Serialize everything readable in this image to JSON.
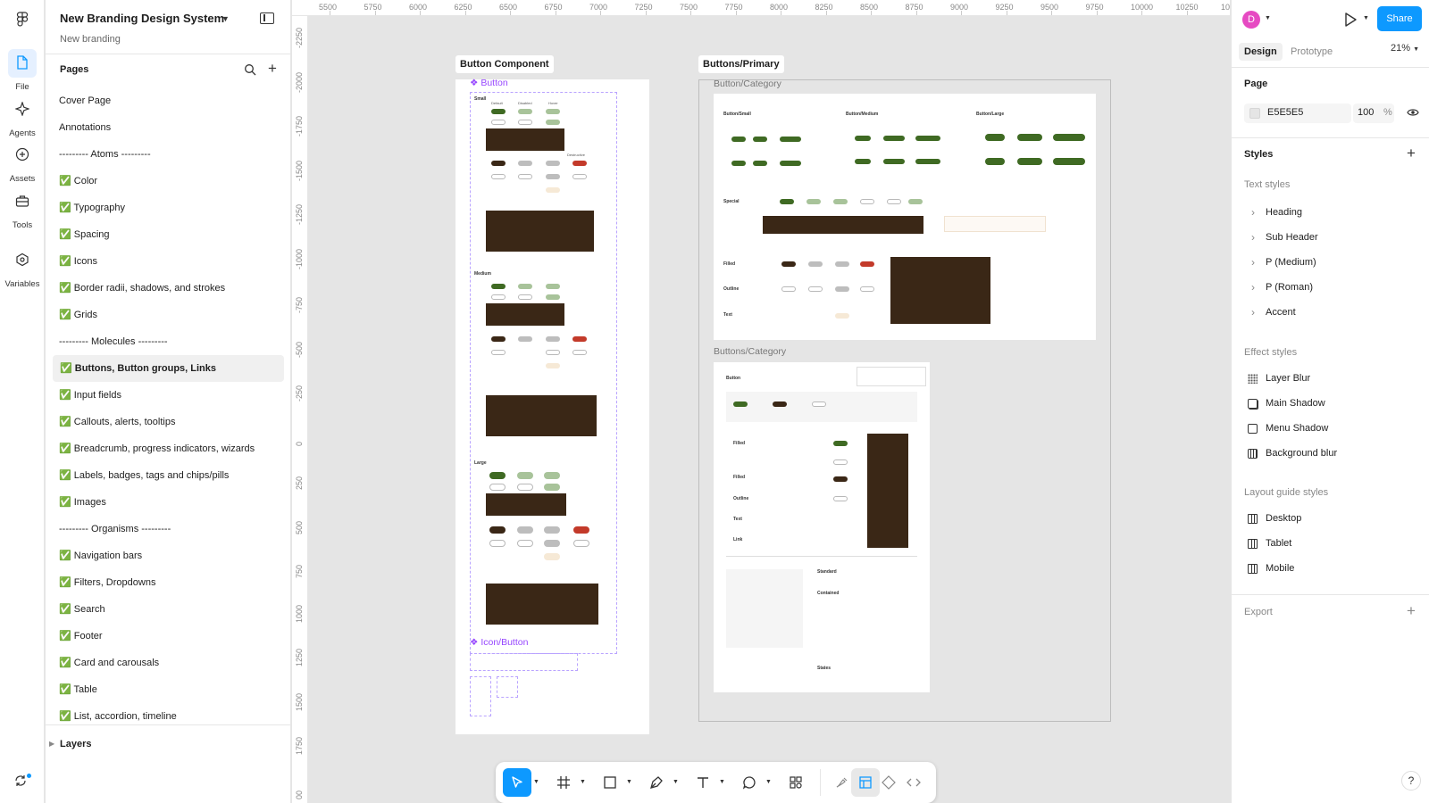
{
  "rail": {
    "items": [
      {
        "label": "File",
        "icon": "file-icon"
      },
      {
        "label": "Agents",
        "icon": "agents-icon"
      },
      {
        "label": "Assets",
        "icon": "assets-icon"
      },
      {
        "label": "Tools",
        "icon": "tools-icon"
      },
      {
        "label": "Variables",
        "icon": "variables-icon"
      }
    ]
  },
  "file": {
    "title": "New Branding Design System",
    "subtitle": "New branding"
  },
  "pages": {
    "header": "Pages",
    "items": [
      "Cover Page",
      "Annotations",
      "--------- Atoms ---------",
      "✅ Color",
      "✅ Typography",
      "✅ Spacing",
      "✅ Icons",
      "✅ Border radii, shadows, and strokes",
      "✅ Grids",
      "--------- Molecules ---------",
      "✅ Buttons, Button groups, Links",
      "✅ Input fields",
      "✅ Callouts, alerts, tooltips",
      "✅  Breadcrumb, progress indicators, wizards",
      "✅ Labels, badges, tags and chips/pills",
      "✅ Images",
      "--------- Organisms ---------",
      "✅ Navigation bars",
      "✅ Filters, Dropdowns",
      "✅ Search",
      "✅ Footer",
      "✅ Card and carousals",
      "✅ Table",
      "✅  List, accordion, timeline"
    ],
    "active_index": 10
  },
  "layers": {
    "header": "Layers"
  },
  "ruler": {
    "top": [
      "5500",
      "5750",
      "6000",
      "6250",
      "6500",
      "6750",
      "7000",
      "7250",
      "7500",
      "7750",
      "8000",
      "8250",
      "8500",
      "8750",
      "9000",
      "9250",
      "9500",
      "9750",
      "10000",
      "10250",
      "10"
    ],
    "left": [
      "-2250",
      "-2000",
      "-1750",
      "-1500",
      "-1250",
      "-1000",
      "-750",
      "-500",
      "-250",
      "0",
      "250",
      "500",
      "750",
      "1000",
      "1250",
      "1500",
      "1750",
      "00"
    ]
  },
  "canvas": {
    "frame1_label": "Button Component",
    "frame2_label": "Buttons/Primary",
    "button_comp": "❖ Button",
    "icon_button_comp": "❖ Icon/Button",
    "category1": "Button/Category",
    "category2": "Buttons/Category",
    "mini": {
      "small": "Small",
      "medium": "Medium",
      "large": "Large",
      "default": "Default",
      "disabled": "Disabled",
      "hover": "Hover",
      "destructive": "Destructive",
      "btn_small": "Button/Small",
      "btn_medium": "Button/Medium",
      "btn_large": "Button/Large",
      "special": "Special",
      "filled": "Filled",
      "outline": "Outline",
      "text": "Text",
      "button": "Button",
      "link": "Link",
      "standard": "Standard",
      "contained": "Contained",
      "states": "States"
    }
  },
  "right": {
    "avatar_letter": "D",
    "share": "Share",
    "tabs": [
      "Design",
      "Prototype"
    ],
    "zoom": "21%",
    "page_section": "Page",
    "page_color": "E5E5E5",
    "page_opacity": "100",
    "page_opacity_unit": "%",
    "styles_section": "Styles",
    "text_styles_label": "Text styles",
    "text_styles": [
      "Heading",
      "Sub Header",
      "P (Medium)",
      "P (Roman)",
      "Accent"
    ],
    "effect_styles_label": "Effect styles",
    "effect_styles": [
      "Layer Blur",
      "Main Shadow",
      "Menu Shadow",
      "Background blur"
    ],
    "layout_guide_label": "Layout guide styles",
    "layout_guides": [
      "Desktop",
      "Tablet",
      "Mobile"
    ],
    "export_section": "Export",
    "help": "?"
  },
  "colors": {
    "accent": "#0d99ff",
    "canvas_bg": "#e5e5e5",
    "component": "#9747ff",
    "brand_green": "#3f6a23",
    "brand_brown": "#3a2716",
    "destructive": "#c33a2a"
  }
}
